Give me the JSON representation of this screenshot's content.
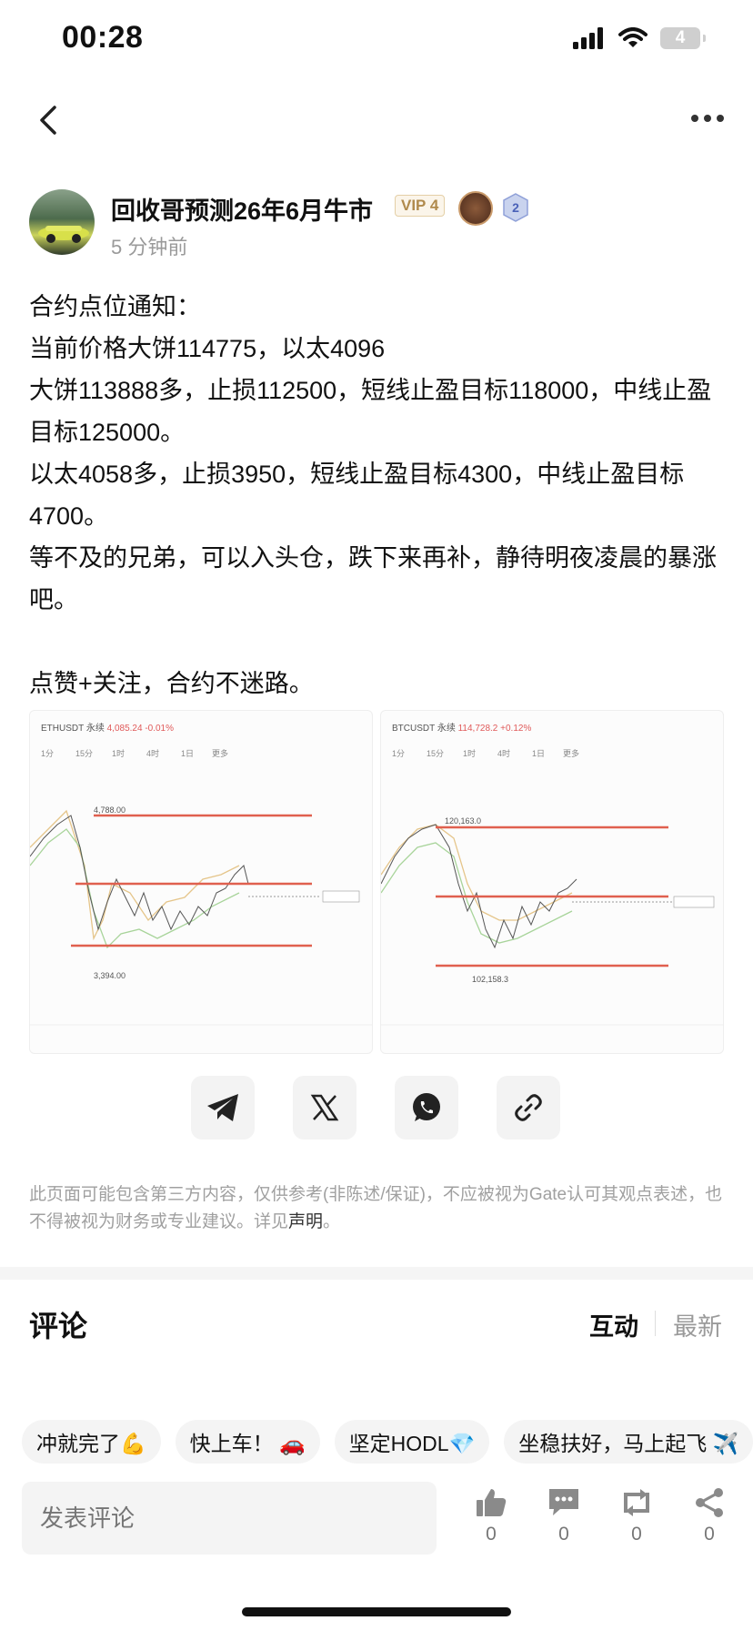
{
  "status_bar": {
    "time": "00:28",
    "battery": "4"
  },
  "author": {
    "name": "回收哥预测26年6月牛市",
    "vip": "VIP 4",
    "level_badge": "2",
    "time_ago": "5 分钟前"
  },
  "post": {
    "lines": [
      "合约点位通知：",
      "当前价格大饼114775，以太4096",
      "大饼113888多，止损112500，短线止盈目标118000，中线止盈目标125000。",
      "以太4058多，止损3950，短线止盈目标4300，中线止盈目标4700。",
      "等不及的兄弟，可以入头仓，跌下来再补，静待明夜凌晨的暴涨吧。",
      "",
      "点赞+关注，合约不迷路。"
    ]
  },
  "charts": [
    {
      "symbol": "ETHUSDT 永续",
      "price": "4,085.24",
      "change": "-0.01%",
      "tabs": [
        "1分",
        "15分",
        "1时",
        "4时",
        "1日",
        "更多"
      ],
      "low_label": "3,394.00",
      "high_label": "4,788.00"
    },
    {
      "symbol": "BTCUSDT 永续",
      "price": "114,728.2",
      "change": "+0.12%",
      "tabs": [
        "1分",
        "15分",
        "1时",
        "4时",
        "1日",
        "更多"
      ],
      "low_label": "102,158.3",
      "high_label": "120,163.0"
    }
  ],
  "share": {
    "icons": [
      "telegram-icon",
      "x-icon",
      "whatsapp-icon",
      "link-icon"
    ]
  },
  "disclaimer": {
    "text": "此页面可能包含第三方内容，仅供参考(非陈述/保证)，不应被视为Gate认可其观点表述，也不得被视为财务或专业建议。详见",
    "link": "声明",
    "end": "。"
  },
  "comments": {
    "title": "评论",
    "tab_hot": "互动",
    "tab_new": "最新"
  },
  "chips": [
    "冲就完了💪",
    "快上车！ 🚗",
    "坚定HODL💎",
    "坐稳扶好，马上起飞 ✈️"
  ],
  "bottom": {
    "placeholder": "发表评论",
    "like_count": "0",
    "comment_count": "0",
    "repost_count": "0",
    "share_count": "0"
  },
  "colors": {
    "red_line": "#e0604f",
    "muted": "#9a9a9a"
  }
}
